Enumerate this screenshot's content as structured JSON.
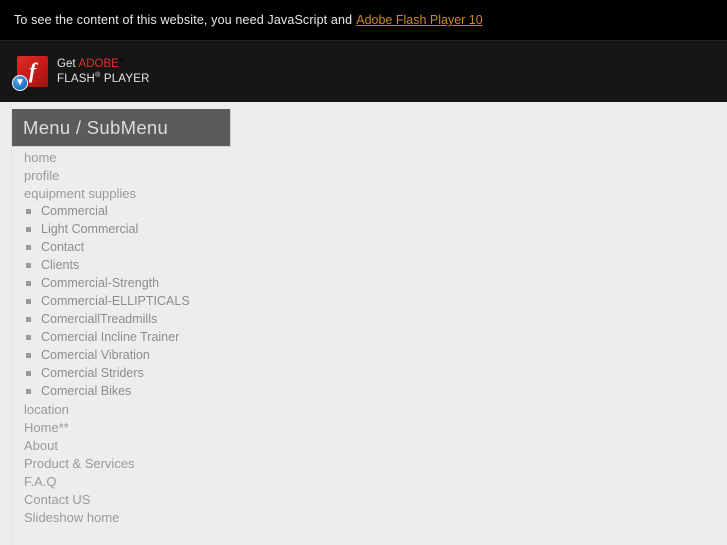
{
  "notice": {
    "text": "To see the content of this website, you need JavaScript and",
    "link_label": "Adobe Flash Player 10",
    "link_color": "#cc8822"
  },
  "flash_badge": {
    "icon": "flash-f-icon",
    "download_icon": "download-arrow-icon",
    "get_label": "Get",
    "adobe_label": "ADOBE",
    "adobe_sup": "®",
    "flash_label": "FLASH",
    "flash_sup": "®",
    "player_label": "PLAYER"
  },
  "menu": {
    "header_title": "Menu / SubMenu",
    "items": [
      {
        "label": "home",
        "level": 1
      },
      {
        "label": "profile",
        "level": 1
      },
      {
        "label": "equipment supplies",
        "level": 1
      },
      {
        "label": "Commercial",
        "level": 2
      },
      {
        "label": "Light Commercial",
        "level": 2
      },
      {
        "label": "Contact",
        "level": 2
      },
      {
        "label": "Clients",
        "level": 2
      },
      {
        "label": "Commercial-Strength",
        "level": 2
      },
      {
        "label": "Commercial-ELLIPTICALS",
        "level": 2
      },
      {
        "label": "ComerciallTreadmills",
        "level": 2
      },
      {
        "label": "Comercial Incline Trainer",
        "level": 2
      },
      {
        "label": "Comercial Vibration",
        "level": 2
      },
      {
        "label": "Comercial Striders",
        "level": 2
      },
      {
        "label": "Comercial Bikes",
        "level": 2
      },
      {
        "label": "location",
        "level": 1
      },
      {
        "label": "Home**",
        "level": 1
      },
      {
        "label": "About",
        "level": 1
      },
      {
        "label": "Product & Services",
        "level": 1
      },
      {
        "label": "F.A.Q",
        "level": 1
      },
      {
        "label": "Contact US",
        "level": 1
      },
      {
        "label": "Slideshow home",
        "level": 1
      }
    ]
  }
}
